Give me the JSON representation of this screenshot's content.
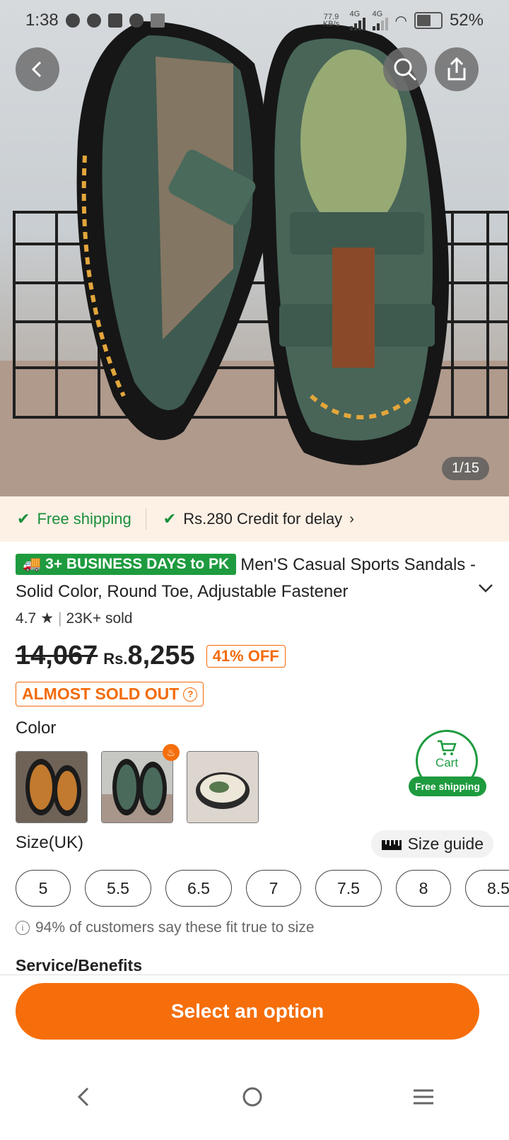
{
  "status": {
    "time": "1:38",
    "speed": "77.9 KB/s",
    "net1": "4G",
    "net2": "4G",
    "battery": "52%"
  },
  "image": {
    "counter": "1/15"
  },
  "shipping": {
    "item1": "Free shipping",
    "item2": "Rs.280 Credit for delay"
  },
  "product": {
    "delivery_badge": "3+ BUSINESS DAYS to PK",
    "title": "Men'S Casual Sports Sandals - Solid Color, Round Toe, Adjustable Fastener",
    "rating": "4.7",
    "sold": "23K+ sold",
    "old_price": "14,067",
    "currency": "Rs.",
    "price": "8,255",
    "discount": "41% OFF",
    "stock_label": "ALMOST SOLD OUT"
  },
  "color": {
    "label": "Color"
  },
  "cart": {
    "label": "Cart",
    "shipping": "Free shipping"
  },
  "size": {
    "label": "Size(UK)",
    "guide": "Size guide",
    "options": [
      "5",
      "5.5",
      "6.5",
      "7",
      "7.5",
      "8",
      "8.5"
    ],
    "fit_note": "94% of customers say these fit true to size"
  },
  "service": {
    "label": "Service/Benefits"
  },
  "cta": {
    "label": "Select an option"
  },
  "colors": {
    "accent": "#f56e0b",
    "green": "#1e9b3f"
  }
}
